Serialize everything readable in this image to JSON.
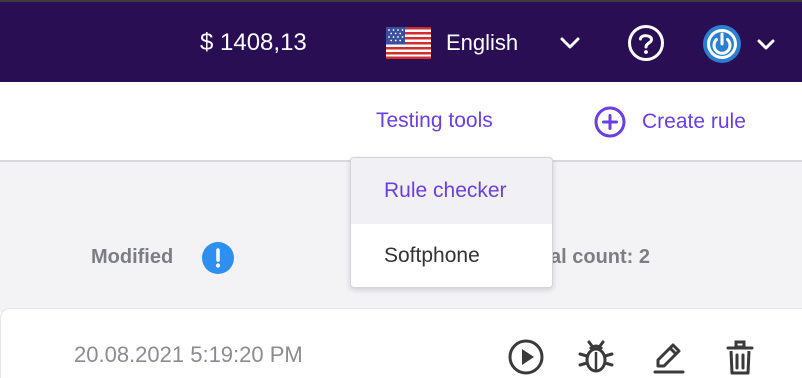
{
  "header": {
    "balance": "$ 1408,13",
    "language": "English",
    "flag_icon": "us-flag-icon",
    "help_icon": "question-circle-icon",
    "avatar_icon": "power-avatar-icon"
  },
  "toolbar": {
    "testing_tools_label": "Testing tools",
    "create_rule_label": "Create rule"
  },
  "testing_menu": {
    "items": [
      {
        "label": "Rule checker",
        "active": true
      },
      {
        "label": "Softphone",
        "active": false
      }
    ]
  },
  "table": {
    "columns": {
      "modified": "Modified",
      "total_count": "al count: 2"
    },
    "rows": [
      {
        "modified": "20.08.2021 5:19:20 PM"
      }
    ]
  },
  "colors": {
    "header_bg": "#2a0e53",
    "accent": "#6a3fe0",
    "alert_blue": "#2f8ff0"
  }
}
